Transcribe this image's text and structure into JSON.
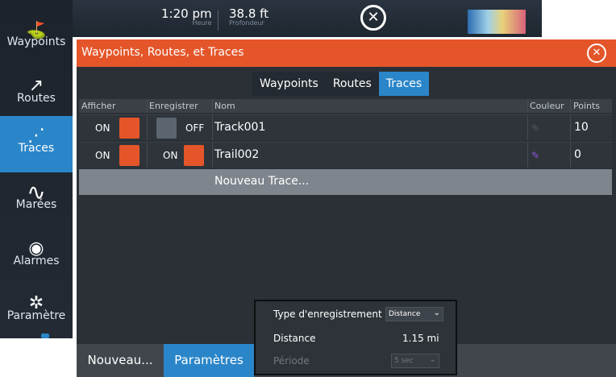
{
  "topbar": {
    "time": "1:20 pm",
    "time_label": "Heure",
    "depth": "38.8 ft",
    "depth_label": "Profondeur"
  },
  "sidebar": {
    "items": [
      {
        "label": "Waypoints",
        "icon": "waypoint-flag-icon",
        "glyph": "⛳",
        "active": false
      },
      {
        "label": "Routes",
        "icon": "route-icon",
        "glyph": "↗",
        "active": false
      },
      {
        "label": "Traces",
        "icon": "trail-icon",
        "glyph": "⋰",
        "active": true
      },
      {
        "label": "Marées",
        "icon": "tide-wave-icon",
        "glyph": "∿",
        "active": false
      },
      {
        "label": "Alarmes",
        "icon": "alarm-icon",
        "glyph": "◉",
        "active": false
      },
      {
        "label": "Paramètre",
        "icon": "gear-icon",
        "glyph": "✲",
        "active": false
      }
    ]
  },
  "panel": {
    "title": "Waypoints, Routes, et Traces",
    "close_glyph": "✕"
  },
  "tabs": [
    {
      "label": "Waypoints",
      "active": false
    },
    {
      "label": "Routes",
      "active": false
    },
    {
      "label": "Traces",
      "active": true
    }
  ],
  "table": {
    "headers": {
      "afficher": "Afficher",
      "enregistrer": "Enregistrer",
      "nom": "Nom",
      "couleur": "Couleur",
      "points": "Points"
    },
    "rows": [
      {
        "afficher": "ON",
        "enregistrer": "OFF",
        "nom": "Track001",
        "points": "10",
        "color": "#3a3f46"
      },
      {
        "afficher": "ON",
        "enregistrer": "ON",
        "nom": "Trail002",
        "points": "0",
        "color": "#8a56d6"
      }
    ],
    "new_row_label": "Nouveau Trace..."
  },
  "bottombar": {
    "new_label": "Nouveau...",
    "params_label": "Paramètres"
  },
  "popup": {
    "type_label": "Type d'enregistrement",
    "type_value": "Distance",
    "distance_label": "Distance",
    "distance_value": "1.15 mi",
    "period_label": "Période",
    "period_value": "5 sec"
  },
  "colors": {
    "accent_orange": "#e4562a",
    "accent_blue": "#2b86c9"
  }
}
